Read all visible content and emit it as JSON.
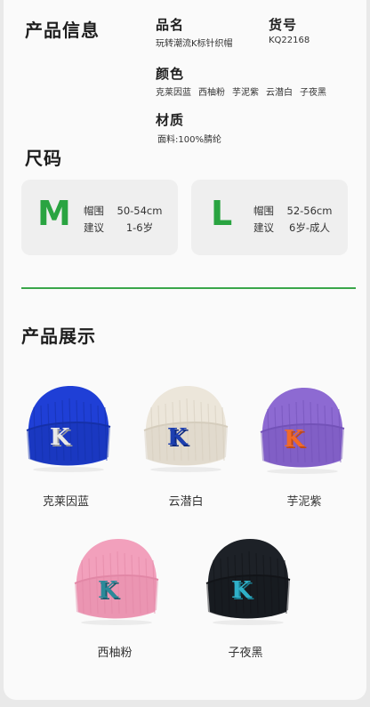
{
  "info": {
    "section_title": "产品信息",
    "name_label": "品名",
    "name_value": "玩转潮流K标针织帽",
    "sku_label": "货号",
    "sku_value": "KQ22168",
    "color_label": "颜色",
    "colors": [
      "克莱因蓝",
      "西柚粉",
      "芋泥紫",
      "云潜白",
      "子夜黑"
    ],
    "material_label": "材质",
    "material_value": "面料:100%腈纶"
  },
  "size": {
    "section_title": "尺码",
    "cards": [
      {
        "letter": "M",
        "circ_label": "帽围",
        "circ_value": "50-54cm",
        "age_label": "建议",
        "age_value": "1-6岁"
      },
      {
        "letter": "L",
        "circ_label": "帽围",
        "circ_value": "52-56cm",
        "age_label": "建议",
        "age_value": "6岁-成人"
      }
    ]
  },
  "showcase": {
    "section_title": "产品展示",
    "hats": [
      {
        "name": "克莱因蓝",
        "body": "#1f3fd6",
        "shade": "#1530a8",
        "logo": "#e8e8e8",
        "logo2": "#9a9a9a"
      },
      {
        "name": "云潜白",
        "body": "#ece6da",
        "shade": "#d5cdbd",
        "logo": "#1d3fb0",
        "logo2": "#0f2a80"
      },
      {
        "name": "芋泥紫",
        "body": "#8d6ad2",
        "shade": "#7352b8",
        "logo": "#f06a2a",
        "logo2": "#c24a14"
      },
      {
        "name": "西柚粉",
        "body": "#f2a0bc",
        "shade": "#e287a6",
        "logo": "#2b8a9a",
        "logo2": "#1b6070"
      },
      {
        "name": "子夜黑",
        "body": "#1d2127",
        "shade": "#121418",
        "logo": "#2fb0c8",
        "logo2": "#1a7c90"
      }
    ]
  }
}
